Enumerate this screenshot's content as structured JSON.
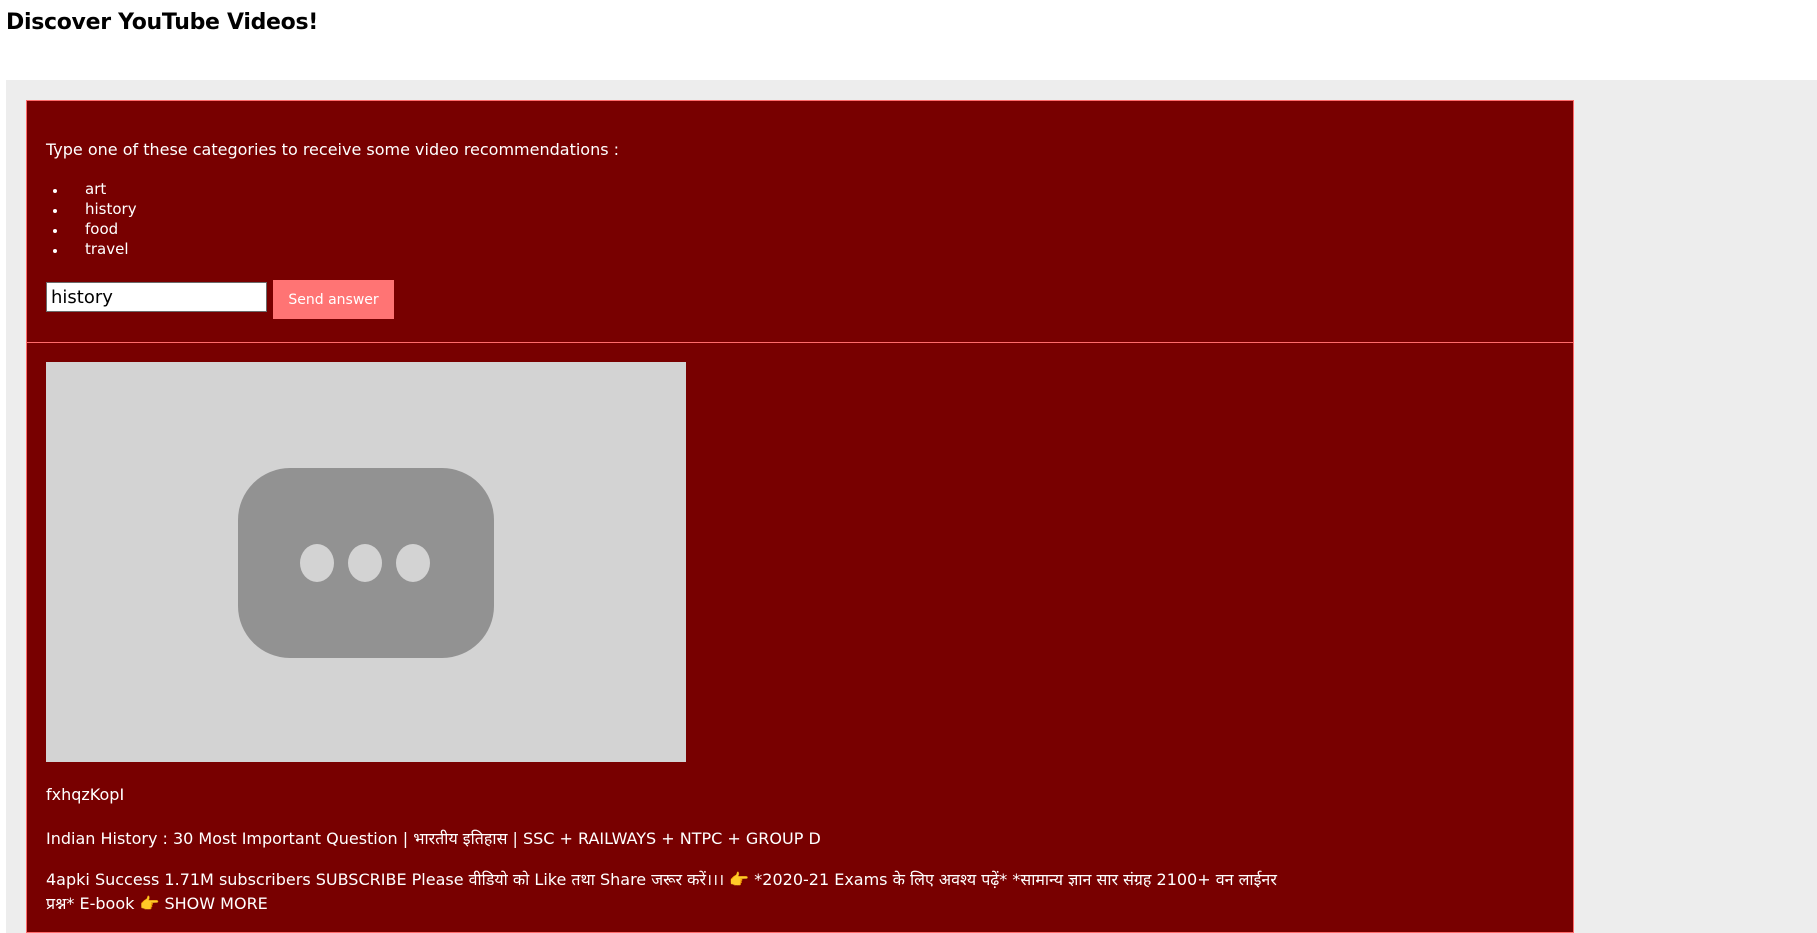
{
  "page": {
    "title": "Discover YouTube Videos!"
  },
  "question": {
    "prompt": "Type one of these categories to receive some video recommendations :",
    "categories": [
      "art",
      "history",
      "food",
      "travel"
    ],
    "input_value": "history",
    "send_label": "Send answer"
  },
  "video": {
    "id": "fxhqzKopI",
    "title": "Indian History : 30 Most Important Question | भारतीय इतिहास | SSC + RAILWAYS + NTPC + GROUP D",
    "description": "4apki Success 1.71M subscribers SUBSCRIBE Please वीडियो को Like तथा Share जरूर करें।।। 👉 *2020-21 Exams के लिए अवश्य पढ़ें* *सामान्य ज्ञान सार संग्रह 2100+ वन लाईनर प्रश्न* E-book 👉 SHOW MORE",
    "placeholder_icon": "loading-dots-icon"
  },
  "colors": {
    "panel_bg": "#780000",
    "accent": "#ff7474",
    "border": "#ff6b6b",
    "outer_bg": "#ededed",
    "player_bg": "#d3d3d3"
  }
}
